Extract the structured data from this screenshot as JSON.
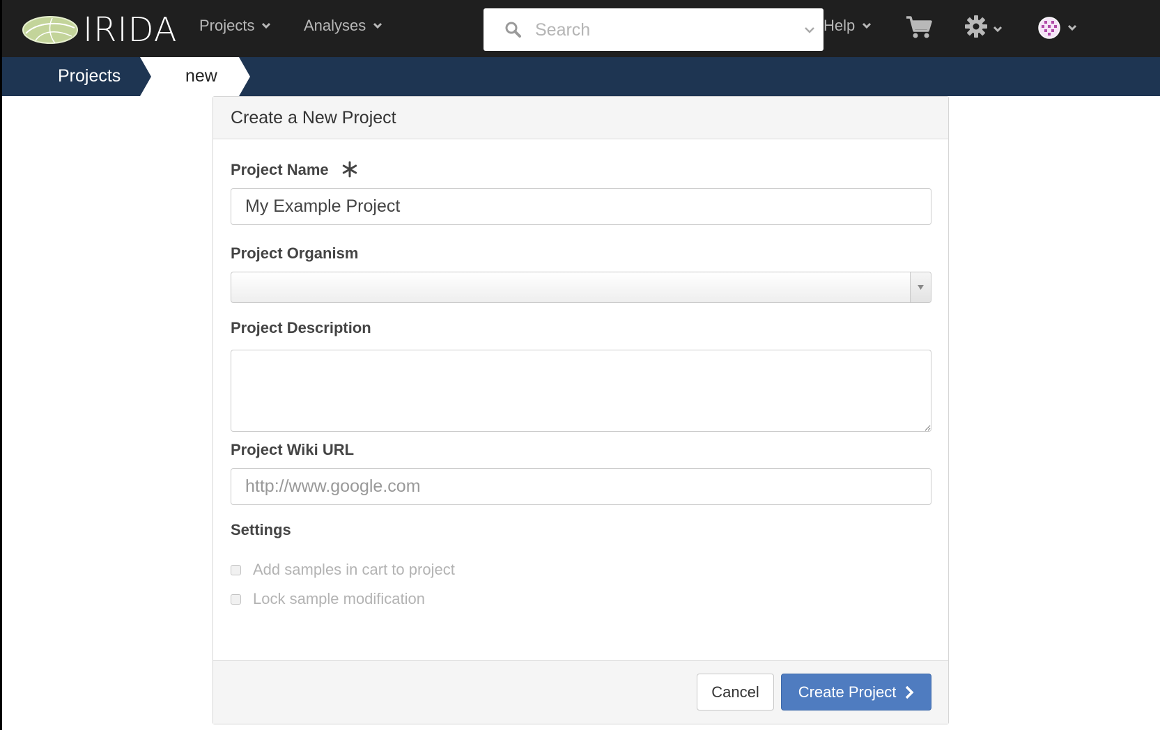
{
  "app": {
    "name": "IRIDA"
  },
  "nav": {
    "projects_label": "Projects",
    "analyses_label": "Analyses",
    "help_label": "Help",
    "search_placeholder": "Search"
  },
  "icons": {
    "logo": "irida-logo-icon",
    "search": "search-icon",
    "cart": "cart-icon",
    "settings": "gear-icon",
    "user": "user-avatar-icon",
    "required": "asterisk-icon"
  },
  "breadcrumb": {
    "items": [
      "Projects",
      "new"
    ]
  },
  "form": {
    "title": "Create a New Project",
    "name_label": "Project Name",
    "name_value": "My Example Project",
    "organism_label": "Project Organism",
    "organism_value": "",
    "description_label": "Project Description",
    "description_value": "",
    "wiki_label": "Project Wiki URL",
    "wiki_placeholder": "http://www.google.com",
    "settings_label": "Settings",
    "settings_options": [
      {
        "label": "Add samples in cart to project",
        "checked": false,
        "disabled": true
      },
      {
        "label": "Lock sample modification",
        "checked": false,
        "disabled": true
      }
    ],
    "cancel_label": "Cancel",
    "submit_label": "Create Project"
  },
  "colors": {
    "navbar_bg": "#1f1f1f",
    "breadcrumb_bg": "#1e3552",
    "primary_button": "#4f7cc0",
    "logo_green": "#c3d49a"
  }
}
